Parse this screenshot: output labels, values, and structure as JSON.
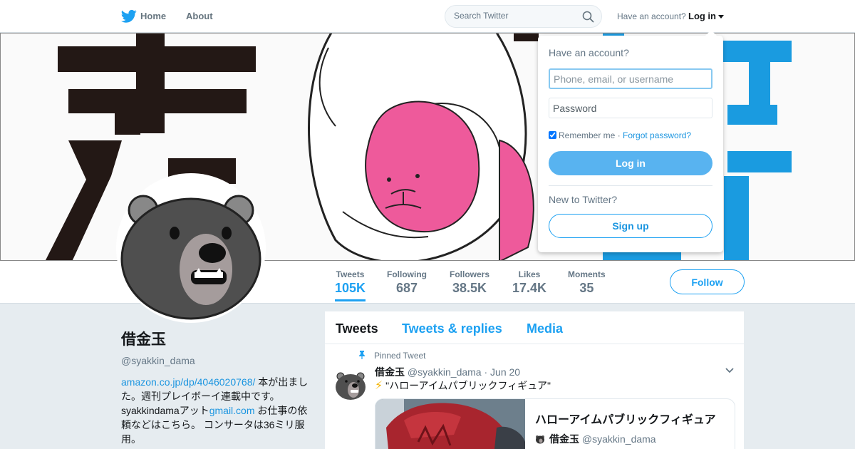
{
  "topnav": {
    "logo_icon": "twitter-bird-icon",
    "home_label": "Home",
    "about_label": "About",
    "search_placeholder": "Search Twitter",
    "account_prompt": "Have an account?",
    "login_label": "Log in"
  },
  "colors": {
    "accent": "#1da1f2",
    "link": "#1b95e0",
    "page_bg": "#e6ecf0",
    "secondary_text": "#657786"
  },
  "profile": {
    "display_name": "借金玉",
    "screen_name": "@syakkin_dama",
    "bio_link1": "amazon.co.jp/dp/4046020768/",
    "bio_text1": " 本が出ました。週刊プレイボーイ連載中です。syakkindamaアット",
    "bio_link2": "gmail.com",
    "bio_text2": " お仕事の依頼などはこちら。 コンサータは36ミリ服用。"
  },
  "stats": [
    {
      "label": "Tweets",
      "value": "105K"
    },
    {
      "label": "Following",
      "value": "687"
    },
    {
      "label": "Followers",
      "value": "38.5K"
    },
    {
      "label": "Likes",
      "value": "17.4K"
    },
    {
      "label": "Moments",
      "value": "35"
    }
  ],
  "follow_label": "Follow",
  "timeline": {
    "tabs": [
      "Tweets",
      "Tweets & replies",
      "Media"
    ],
    "pinned_label": "Pinned Tweet",
    "tweet": {
      "name": "借金玉",
      "handle": "@syakkin_dama",
      "date": "· Jun 20",
      "bolt": "⚡",
      "text": " \"ハローアイムパブリックフィギュア\"",
      "card_title": "ハローアイムパブリックフィギュア",
      "card_name": "借金玉",
      "card_handle": "@syakkin_dama"
    }
  },
  "login_dropdown": {
    "heading": "Have an account?",
    "username_placeholder": "Phone, email, or username",
    "password_placeholder": "Password",
    "remember_label": "Remember me",
    "separator": " · ",
    "forgot_label": "Forgot password?",
    "login_button": "Log in",
    "new_prompt": "New to Twitter?",
    "signup_button": "Sign up"
  }
}
